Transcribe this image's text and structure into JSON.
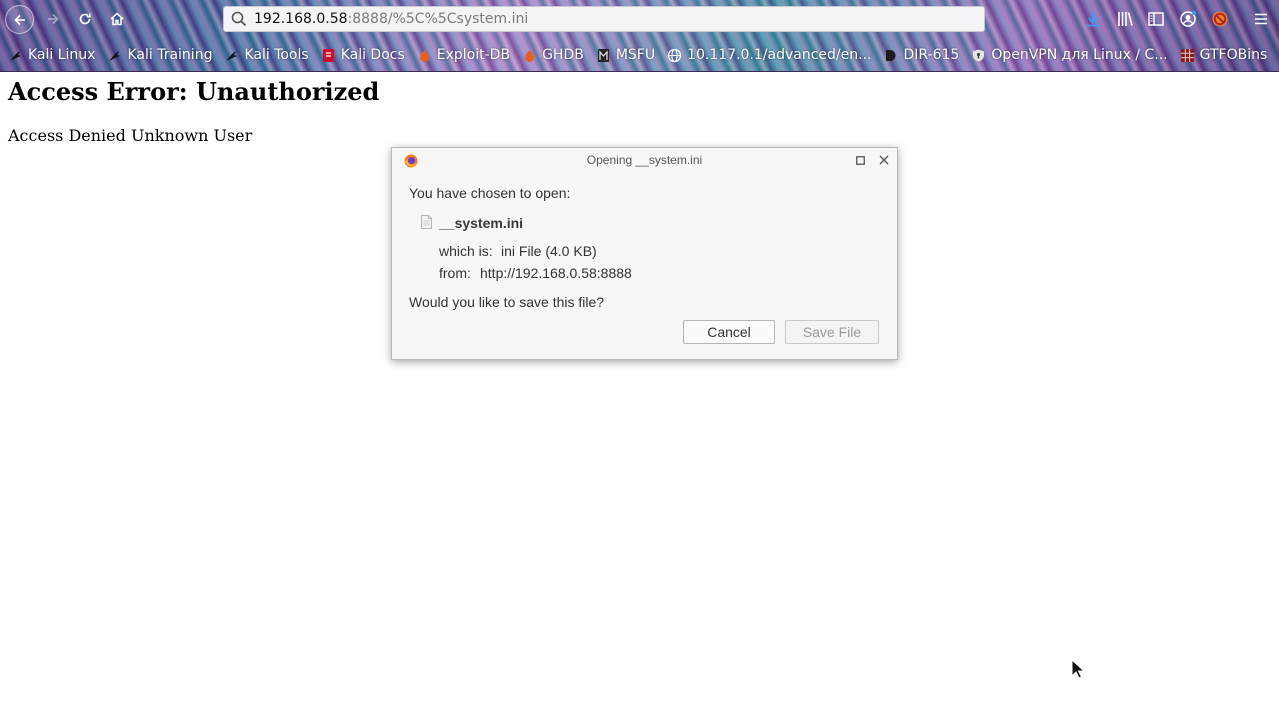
{
  "browser": {
    "url_host": "192.168.0.58",
    "url_rest": ":8888/%5C%5Csystem.ini",
    "icons": {
      "back": "back-arrow-icon",
      "forward": "forward-arrow-icon",
      "reload": "reload-icon",
      "home": "home-icon",
      "search": "search-icon",
      "downloads": "download-icon",
      "library": "library-icon",
      "sidebar": "sidebar-icon",
      "account": "account-icon",
      "addon": "addon-icon",
      "menu": "hamburger-menu-icon"
    },
    "bookmarks": [
      {
        "label": "Kali Linux",
        "icon": "kali-dragon-icon"
      },
      {
        "label": "Kali Training",
        "icon": "kali-dragon-icon"
      },
      {
        "label": "Kali Tools",
        "icon": "kali-dragon-icon"
      },
      {
        "label": "Kali Docs",
        "icon": "kali-docs-icon"
      },
      {
        "label": "Exploit-DB",
        "icon": "exploit-db-icon"
      },
      {
        "label": "GHDB",
        "icon": "ghdb-icon"
      },
      {
        "label": "MSFU",
        "icon": "msfu-icon"
      },
      {
        "label": "10.117.0.1/advanced/en...",
        "icon": "globe-icon"
      },
      {
        "label": "DIR-615",
        "icon": "dlink-icon"
      },
      {
        "label": "OpenVPN для Linux / C...",
        "icon": "shield-icon"
      },
      {
        "label": "GTFOBins",
        "icon": "gtfobins-icon"
      }
    ]
  },
  "page": {
    "heading": "Access Error: Unauthorized",
    "message": "Access Denied Unknown User"
  },
  "dialog": {
    "title": "Opening __system.ini",
    "prompt": "You have chosen to open:",
    "file_name": "__system.ini",
    "which_label": "which is:",
    "which_value": "ini File (4.0 KB)",
    "from_label": "from:",
    "from_value": "http://192.168.0.58:8888",
    "question": "Would you like to save this file?",
    "cancel_label": "Cancel",
    "save_label": "Save File"
  },
  "colors": {
    "accent": "#3b7dd8",
    "dialog_bg": "#f7f7f7",
    "disabled_text": "#9a9a9a"
  }
}
